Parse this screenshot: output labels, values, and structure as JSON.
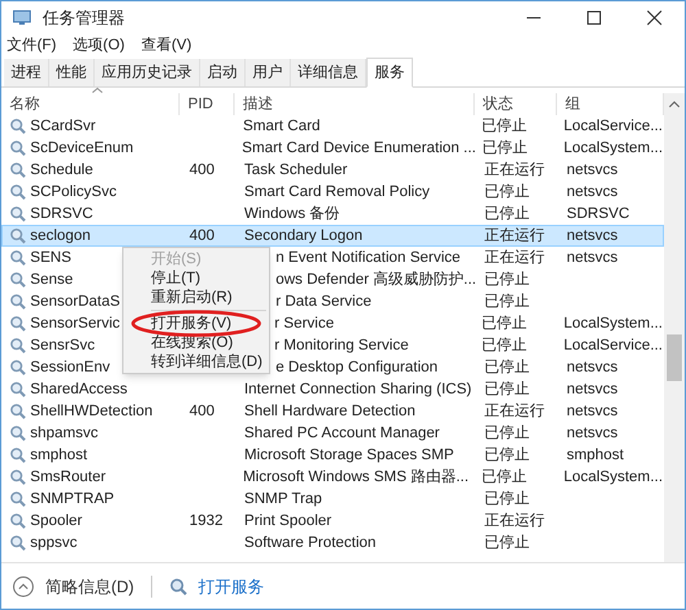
{
  "window": {
    "title": "任务管理器"
  },
  "menu_bar": [
    "文件(F)",
    "选项(O)",
    "查看(V)"
  ],
  "tabs": [
    {
      "label": "进程",
      "selected": false
    },
    {
      "label": "性能",
      "selected": false
    },
    {
      "label": "应用历史记录",
      "selected": false
    },
    {
      "label": "启动",
      "selected": false
    },
    {
      "label": "用户",
      "selected": false
    },
    {
      "label": "详细信息",
      "selected": false
    },
    {
      "label": "服务",
      "selected": true
    }
  ],
  "table": {
    "columns": [
      "名称",
      "PID",
      "描述",
      "状态",
      "组"
    ],
    "rows": [
      {
        "name": "SCardSvr",
        "description": "Smart Card",
        "status": "已停止",
        "group": "LocalService...",
        "selected": false
      },
      {
        "name": "ScDeviceEnum",
        "description": "Smart Card Device Enumeration ...",
        "status": "已停止",
        "group": "LocalSystem...",
        "selected": false
      },
      {
        "name": "Schedule",
        "pid": "400",
        "description": "Task Scheduler",
        "status": "正在运行",
        "group": "netsvcs",
        "selected": false
      },
      {
        "name": "SCPolicySvc",
        "description": "Smart Card Removal Policy",
        "status": "已停止",
        "group": "netsvcs",
        "selected": false
      },
      {
        "name": "SDRSVC",
        "description": "Windows 备份",
        "status": "已停止",
        "group": "SDRSVC",
        "selected": false
      },
      {
        "name": "seclogon",
        "pid": "400",
        "description": "Secondary Logon",
        "status": "正在运行",
        "group": "netsvcs",
        "selected": true
      },
      {
        "name": "SENS",
        "description": "n Event Notification Service",
        "status": "正在运行",
        "group": "netsvcs",
        "selected": false
      },
      {
        "name": "Sense",
        "description": "ows Defender 高级威胁防护...",
        "status": "已停止",
        "selected": false
      },
      {
        "name": "SensorDataS",
        "description": "r Data Service",
        "status": "已停止",
        "selected": false
      },
      {
        "name": "SensorServic",
        "description": "r Service",
        "status": "已停止",
        "group": "LocalSystem...",
        "selected": false
      },
      {
        "name": "SensrSvc",
        "description": "r Monitoring Service",
        "status": "已停止",
        "group": "LocalService...",
        "selected": false
      },
      {
        "name": "SessionEnv",
        "description": "e Desktop Configuration",
        "status": "已停止",
        "group": "netsvcs",
        "selected": false
      },
      {
        "name": "SharedAccess",
        "description": "Internet Connection Sharing (ICS)",
        "status": "已停止",
        "group": "netsvcs",
        "selected": false
      },
      {
        "name": "ShellHWDetection",
        "pid": "400",
        "description": "Shell Hardware Detection",
        "status": "正在运行",
        "group": "netsvcs",
        "selected": false
      },
      {
        "name": "shpamsvc",
        "description": "Shared PC Account Manager",
        "status": "已停止",
        "group": "netsvcs",
        "selected": false
      },
      {
        "name": "smphost",
        "description": "Microsoft Storage Spaces SMP",
        "status": "已停止",
        "group": "smphost",
        "selected": false
      },
      {
        "name": "SmsRouter",
        "description": "Microsoft Windows SMS 路由器...",
        "status": "已停止",
        "group": "LocalSystem...",
        "selected": false
      },
      {
        "name": "SNMPTRAP",
        "description": "SNMP Trap",
        "status": "已停止",
        "selected": false
      },
      {
        "name": "Spooler",
        "pid": "1932",
        "description": "Print Spooler",
        "status": "正在运行",
        "selected": false
      },
      {
        "name": "sppsvc",
        "description": "Software Protection",
        "status": "已停止",
        "selected": false
      }
    ]
  },
  "context_menu": {
    "items": [
      {
        "kind": "item",
        "label": "开始(S)",
        "disabled": true
      },
      {
        "kind": "item",
        "label": "停止(T)",
        "disabled": false
      },
      {
        "kind": "item",
        "label": "重新启动(R)",
        "disabled": false
      },
      {
        "kind": "separator"
      },
      {
        "kind": "item",
        "label": "打开服务(V)",
        "disabled": false
      },
      {
        "kind": "item",
        "label": "在线搜索(O)",
        "disabled": false
      },
      {
        "kind": "item",
        "label": "转到详细信息(D)",
        "disabled": false
      }
    ]
  },
  "footer": {
    "details_toggle": "简略信息(D)",
    "link": "打开服务"
  }
}
